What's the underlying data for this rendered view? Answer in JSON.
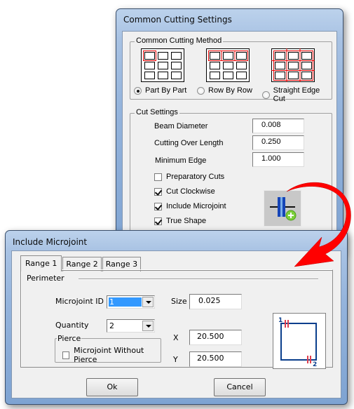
{
  "main_window": {
    "title": "Common Cutting Settings",
    "method_group": {
      "label": "Common Cutting Method",
      "options": [
        {
          "label": "Part By Part",
          "selected": true,
          "icon": "part-by-part-diagram-icon"
        },
        {
          "label": "Row By Row",
          "selected": false,
          "icon": "row-by-row-diagram-icon"
        },
        {
          "label": "Straight Edge Cut",
          "selected": false,
          "icon": "straight-edge-cut-diagram-icon"
        }
      ]
    },
    "cut_settings": {
      "label": "Cut Settings",
      "fields": [
        {
          "label": "Beam Diameter",
          "value": "0.008"
        },
        {
          "label": "Cutting Over Length",
          "value": "0.250"
        },
        {
          "label": "Minimum Edge",
          "value": "1.000"
        }
      ],
      "checkboxes": [
        {
          "label": "Preparatory Cuts",
          "checked": false
        },
        {
          "label": "Cut Clockwise",
          "checked": true
        },
        {
          "label": "Include Microjoint",
          "checked": true
        },
        {
          "label": "True Shape",
          "checked": true
        }
      ],
      "microjoint_button_icon": "add-microjoint-icon"
    }
  },
  "dialog": {
    "title": "Include Microjoint",
    "tabs": [
      {
        "label": "Range 1",
        "active": true
      },
      {
        "label": "Range 2",
        "active": false
      },
      {
        "label": "Range 3",
        "active": false
      }
    ],
    "section_label": "Perimeter",
    "microjoint_id": {
      "label": "Microjoint ID",
      "value": "1"
    },
    "quantity": {
      "label": "Quantity",
      "value": "2"
    },
    "size": {
      "label": "Size",
      "value": "0.025"
    },
    "x": {
      "label": "X",
      "value": "20.500"
    },
    "y": {
      "label": "Y",
      "value": "20.500"
    },
    "pierce": {
      "label": "Pierce",
      "checkbox_label": "Microjoint Without Pierce",
      "checked": false
    },
    "preview": {
      "marker_1": "1",
      "marker_2": "2"
    },
    "ok_label": "Ok",
    "cancel_label": "Cancel"
  },
  "colors": {
    "accent_red": "#e60000",
    "diagram_blue": "#0a3e8c",
    "selection_blue": "#3399ff"
  }
}
